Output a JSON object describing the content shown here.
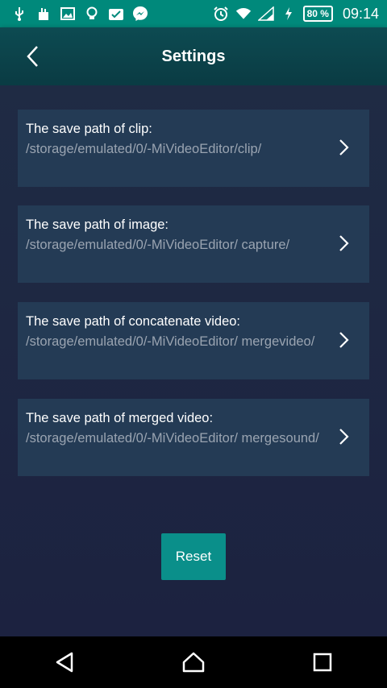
{
  "status_bar": {
    "battery": "80 %",
    "time": "09:14",
    "icons_left": [
      "usb-icon",
      "cleaner-icon",
      "image-icon",
      "bulb-icon",
      "photo-check-icon",
      "messenger-icon"
    ],
    "icons_right": [
      "alarm-icon",
      "wifi-icon",
      "signal-icon",
      "charging-icon"
    ]
  },
  "app_bar": {
    "title": "Settings",
    "back_icon": "chevron-left-icon"
  },
  "settings": [
    {
      "title": "The save path of clip:",
      "path": "/storage/emulated/0/-MiVideoEditor/clip/"
    },
    {
      "title": "The save path of image:",
      "path": "/storage/emulated/0/-MiVideoEditor/ capture/"
    },
    {
      "title": "The save path of concatenate video:",
      "path": "/storage/emulated/0/-MiVideoEditor/ mergevideo/"
    },
    {
      "title": "The save path of merged video:",
      "path": "/storage/emulated/0/-MiVideoEditor/ mergesound/"
    }
  ],
  "reset_label": "Reset",
  "nav_bar": {
    "icons": [
      "back-triangle-icon",
      "home-icon",
      "recents-icon"
    ]
  },
  "colors": {
    "status_bar": "#00897b",
    "app_bar": "#0b4149",
    "background": "#1c2440",
    "card": "#243b55",
    "card_title": "#ffffff",
    "card_path": "#9aa4b1",
    "reset_button": "#0a8f8a"
  }
}
